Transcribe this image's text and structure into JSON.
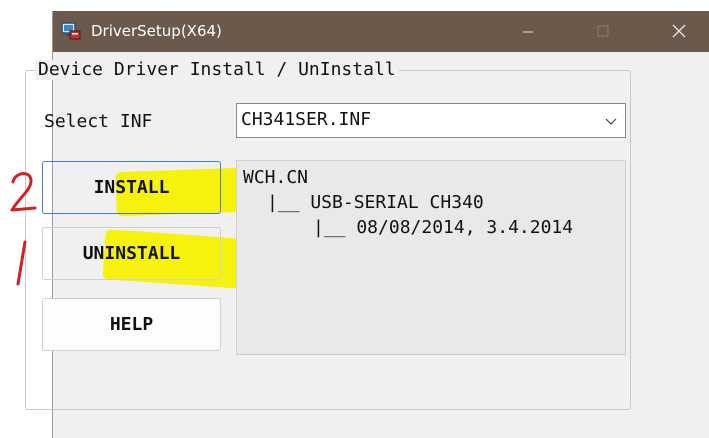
{
  "window": {
    "title": "DriverSetup(X64)",
    "controls": {
      "minimize": "minimize",
      "maximize": "maximize",
      "close": "close"
    }
  },
  "group": {
    "title": "Device Driver Install / UnInstall"
  },
  "select_inf": {
    "label": "Select INF",
    "value": "CH341SER.INF"
  },
  "buttons": {
    "install": "INSTALL",
    "uninstall": "UNINSTALL",
    "help": "HELP"
  },
  "info": {
    "lines": [
      "WCH.CN",
      "|__ USB-SERIAL CH340",
      "|__ 08/08/2014, 3.4.2014"
    ]
  },
  "annotations": {
    "install_number": "2",
    "uninstall_number": "1",
    "ink_color": "#d62020",
    "highlight_color": "#f6f000"
  },
  "colors": {
    "titlebar": "#6b5a4c",
    "dialog": "#f0f0f0",
    "accent": "#3f7ed3"
  }
}
